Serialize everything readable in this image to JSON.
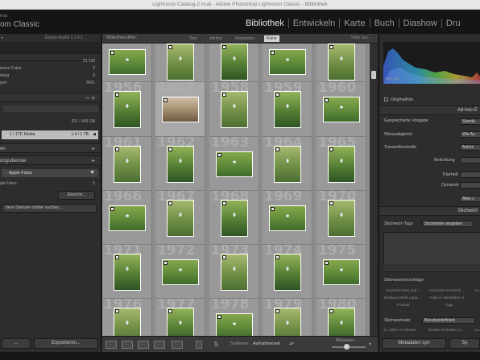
{
  "window": {
    "title": "Lightroom Catalog-2.lrcat - Adobe Photoshop Lightroom Classic - Bibliothek"
  },
  "identity": {
    "app_small": "hop",
    "app_big": "om Classic"
  },
  "modules": [
    "Bibliothek",
    "Entwickeln",
    "Karte",
    "Buch",
    "Diashow",
    "Dru"
  ],
  "left_panel": {
    "catalog_rows": [
      {
        "label": "",
        "value": "23.198"
      },
      {
        "label": "ierten Fotos",
        "value": "0"
      },
      {
        "label": "dung",
        "value": "0"
      },
      {
        "label": "port",
        "value": "3691"
      }
    ],
    "folders_value": "201 / 449 GB",
    "volume_label": "1 / 1TC Media",
    "volume_value": "1,4 / 1 TB",
    "collections_header": "en",
    "publish_header": "ungsdienste",
    "apple_fotos": ": Apple Fotos",
    "apple_sub": "ple Fotos",
    "apple_sub_value": "5",
    "setup_button": "Einricht...",
    "find_more": "itere Dienste online suchen..."
  },
  "filter_bar": {
    "label": "Bibliotheksfilter:",
    "tabs": [
      "Text",
      "Attribut",
      "Metadaten",
      "Keine"
    ],
    "active_tab": "Keine",
    "filter_off": "Filter aus –"
  },
  "grid": {
    "years": [
      [
        "",
        "",
        "",
        "",
        ""
      ],
      [
        "1956",
        "1957",
        "1958",
        "1959",
        "1960"
      ],
      [
        "1961",
        "1962",
        "1963",
        "1964",
        "1965"
      ],
      [
        "1966",
        "1967",
        "1968",
        "1969",
        "1970"
      ],
      [
        "1971",
        "1972",
        "1973",
        "1974",
        "1975"
      ],
      [
        "1976",
        "1977",
        "1978",
        "1979",
        "1980"
      ]
    ]
  },
  "toolbar": {
    "sort_label": "Sortieren:",
    "sort_value": "Aufnahmezeit",
    "thumb_label": "Miniaturen"
  },
  "right_panel": {
    "histogram_labels": [
      "ISO 100",
      "33 mm",
      "f / 8,0"
    ],
    "original_photo": "Originalfoto",
    "quick_develop_header": "Ad-hoc-E",
    "saved_preset_label": "Gespeicherte Vorgabe",
    "saved_preset_value": "Standa",
    "white_balance_label": "Weissabgleich",
    "white_balance_value": "Wie Au",
    "tone_label": "Tonwertkontrolle",
    "tone_value": "Autom",
    "exposure_label": "Belichtung",
    "clarity_label": "Klarheit",
    "vibrance_label": "Dynamik",
    "reset_button": "Alles z",
    "keywords_header": "Stichwört",
    "keyword_tags_label": "Stichwort-Tags",
    "keyword_tags_value": "Stichwörter eingeben",
    "suggestions_header": "Stichwortvorschläge",
    "suggestions": [
      [
        "Hochzeit Ines und ...",
        "Hochzeit Hendrick ...",
        "Au"
      ],
      [
        "Barbara Diehl Lapp...",
        "Halle in Westfalen S...",
        ""
      ],
      [
        "Portrait",
        "Inge",
        ""
      ]
    ],
    "keyword_set_label": "Stichwortsatz",
    "keyword_set_value": "Benutzerdefiniert",
    "keyword_set_items": [
      "41 Jahre Ar Zenrat...",
      "Torsten Schuster Ar...",
      "Ca"
    ]
  },
  "bottom_buttons": {
    "import": "...",
    "export": "Exportieren...",
    "metadata_sync": "Metadaten syn",
    "sync_right": "Sy"
  }
}
